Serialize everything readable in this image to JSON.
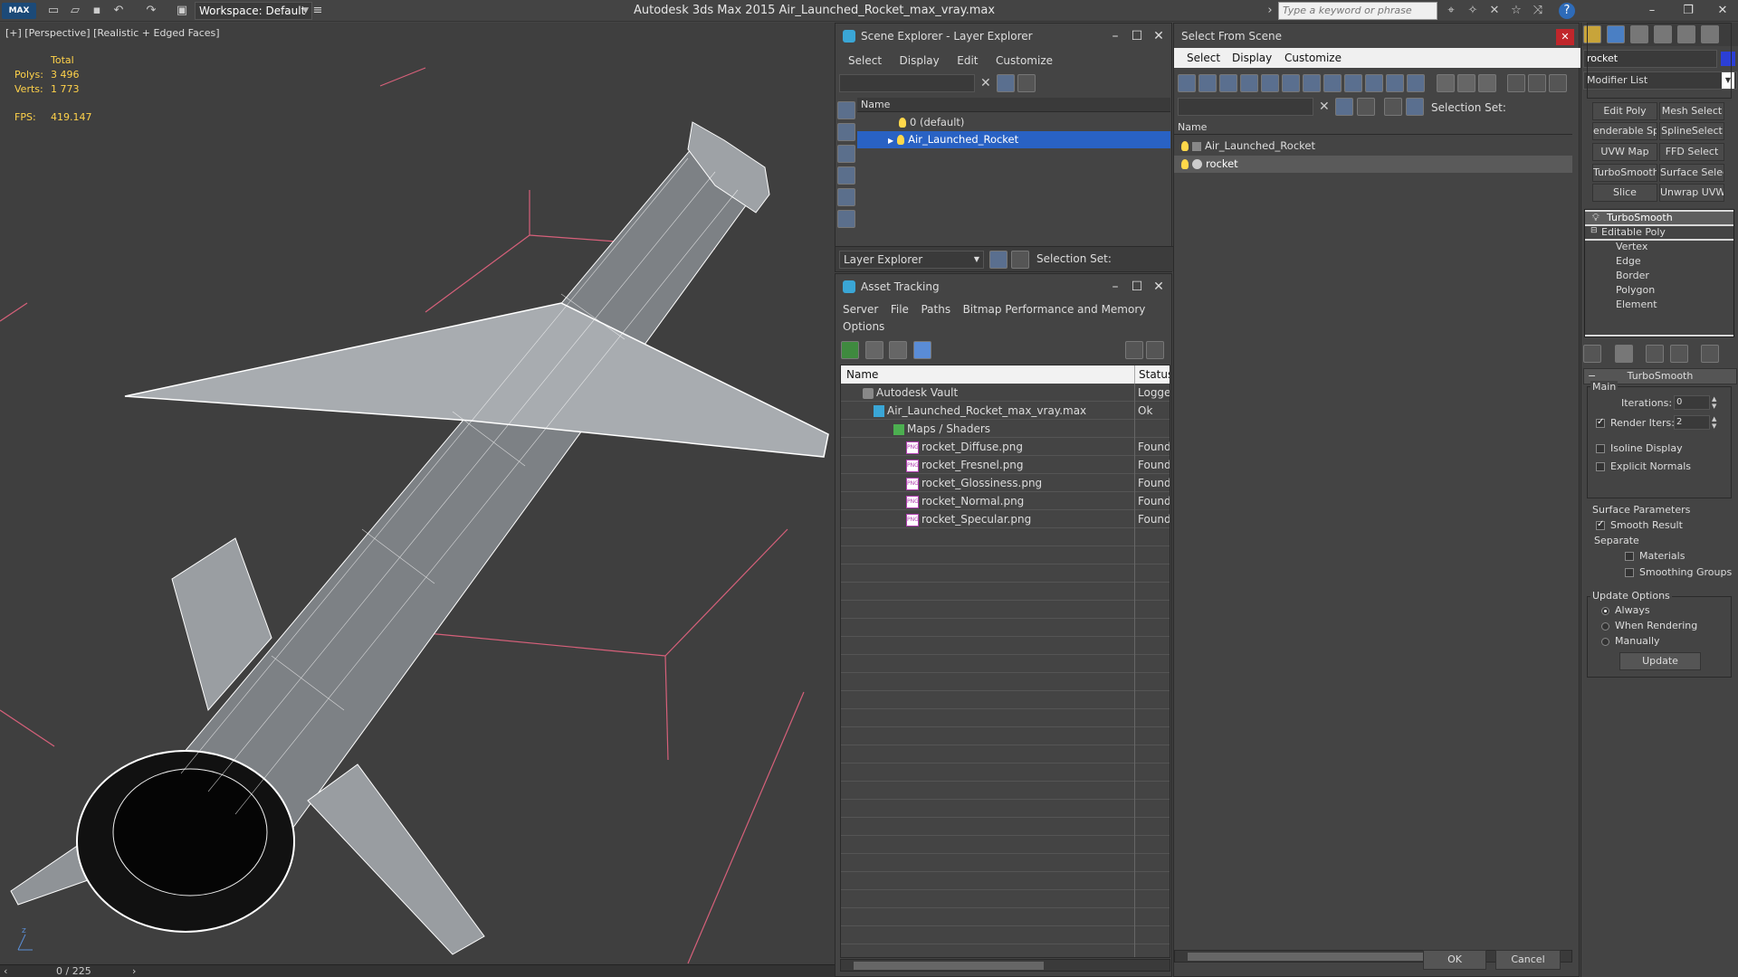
{
  "app": {
    "title": "Autodesk 3ds Max  2015     Air_Launched_Rocket_max_vray.max",
    "logo": "MAX",
    "workspace": "Workspace: Default",
    "search_placeholder": "Type a keyword or phrase"
  },
  "viewport": {
    "label": "[+] [Perspective] [Realistic + Edged Faces]",
    "stats": {
      "total_label": "Total",
      "polys_label": "Polys:",
      "polys": "3 496",
      "verts_label": "Verts:",
      "verts": "1 773",
      "fps_label": "FPS:",
      "fps": "419.147"
    },
    "timeslider": "0 / 225"
  },
  "scene_explorer": {
    "title": "Scene Explorer - Layer Explorer",
    "menu": [
      "Select",
      "Display",
      "Edit",
      "Customize"
    ],
    "col_name": "Name",
    "items": [
      {
        "label": "0 (default)",
        "selected": false
      },
      {
        "label": "Air_Launched_Rocket",
        "selected": true
      }
    ],
    "footer_dropdown": "Layer Explorer",
    "selection_set": "Selection Set:"
  },
  "asset_tracking": {
    "title": "Asset Tracking",
    "menu": [
      "Server",
      "File",
      "Paths",
      "Bitmap Performance and Memory"
    ],
    "menu2": "Options",
    "col_name": "Name",
    "col_status": "Status",
    "rows": [
      {
        "name": "Autodesk Vault",
        "status": "Logged",
        "icon": "vault-icon"
      },
      {
        "name": "Air_Launched_Rocket_max_vray.max",
        "status": "Ok",
        "icon": "max-file-icon"
      },
      {
        "name": "Maps / Shaders",
        "status": "",
        "icon": "maps-icon"
      },
      {
        "name": "rocket_Diffuse.png",
        "status": "Found",
        "icon": "png-icon"
      },
      {
        "name": "rocket_Fresnel.png",
        "status": "Found",
        "icon": "png-icon"
      },
      {
        "name": "rocket_Glossiness.png",
        "status": "Found",
        "icon": "png-icon"
      },
      {
        "name": "rocket_Normal.png",
        "status": "Found",
        "icon": "png-icon"
      },
      {
        "name": "rocket_Specular.png",
        "status": "Found",
        "icon": "png-icon"
      }
    ]
  },
  "select_from_scene": {
    "title": "Select From Scene",
    "menu": [
      "Select",
      "Display",
      "Customize"
    ],
    "selection_set": "Selection Set:",
    "col_name": "Name",
    "items": [
      {
        "label": "Air_Launched_Rocket",
        "selected": false
      },
      {
        "label": "rocket",
        "selected": true
      }
    ],
    "ok": "OK",
    "cancel": "Cancel"
  },
  "command_panel": {
    "object_name": "rocket",
    "object_color": "#2b3fd6",
    "modifier_list": "Modifier List",
    "buttons": [
      "Edit Poly",
      "Mesh Select",
      "enderable Splir",
      "SplineSelect",
      "UVW Map",
      "FFD Select",
      "TurboSmooth",
      "Surface Select",
      "Slice",
      "Unwrap UVW"
    ],
    "stack": [
      "TurboSmooth",
      "Editable Poly",
      "Vertex",
      "Edge",
      "Border",
      "Polygon",
      "Element"
    ],
    "rollout_title": "TurboSmooth",
    "main_label": "Main",
    "iterations_label": "Iterations:",
    "iterations": "0",
    "render_iters_label": "Render Iters:",
    "render_iters": "2",
    "render_iters_checked": true,
    "isoline": "Isoline Display",
    "explicit": "Explicit Normals",
    "surface_params": "Surface Parameters",
    "smooth_result": "Smooth Result",
    "separate": "Separate",
    "materials": "Materials",
    "smoothing_groups": "Smoothing Groups",
    "update_options": "Update Options",
    "always": "Always",
    "when_rendering": "When Rendering",
    "manually": "Manually",
    "update": "Update"
  }
}
